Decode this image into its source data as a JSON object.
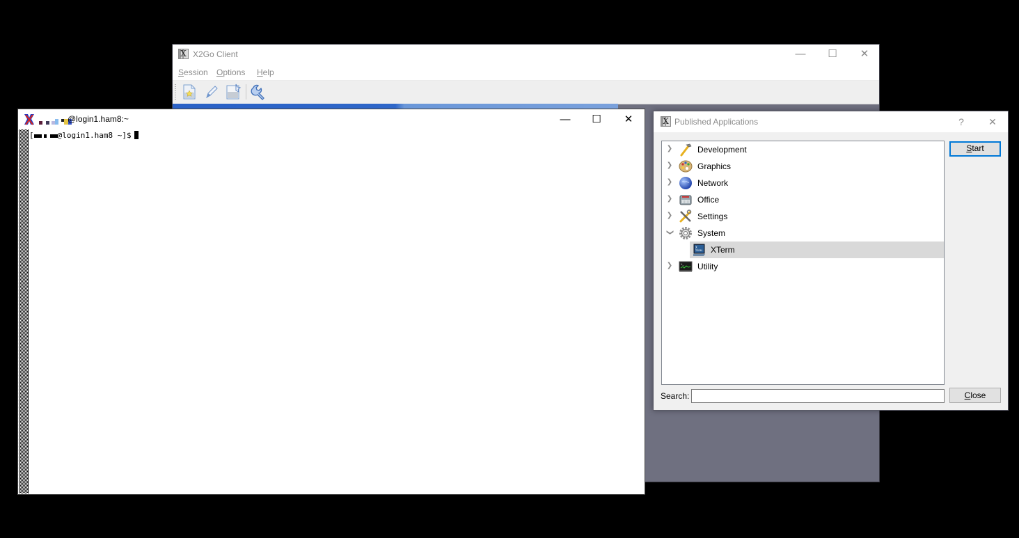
{
  "x2go": {
    "title": "X2Go Client",
    "menu": [
      {
        "label": "Session",
        "mnemonic": "S",
        "rest": "ession"
      },
      {
        "label": "Options",
        "mnemonic": "O",
        "rest": "ptions"
      },
      {
        "label": "Help",
        "mnemonic": "H",
        "rest": "elp"
      }
    ],
    "toolbar": [
      {
        "name": "new-session",
        "icon": "new-session-icon"
      },
      {
        "name": "edit-session",
        "icon": "pencil-icon"
      },
      {
        "name": "create-shortcut",
        "icon": "shortcut-icon"
      },
      {
        "name": "preferences",
        "icon": "wrench-icon"
      }
    ],
    "window_buttons": {
      "minimize": "—",
      "maximize": "☐",
      "close": "✕"
    }
  },
  "xterm": {
    "title_suffix": "@login1.ham8:~",
    "prompt_prefix": "[",
    "prompt_suffix": "@login1.ham8 ~]$",
    "window_buttons": {
      "minimize": "—",
      "maximize": "☐",
      "close": "✕"
    }
  },
  "published_apps": {
    "title": "Published Applications",
    "help_button": "?",
    "close_x": "✕",
    "categories": [
      {
        "label": "Development",
        "icon": "hammer-icon",
        "expanded": false
      },
      {
        "label": "Graphics",
        "icon": "palette-icon",
        "expanded": false
      },
      {
        "label": "Network",
        "icon": "globe-icon",
        "expanded": false
      },
      {
        "label": "Office",
        "icon": "typewriter-icon",
        "expanded": false
      },
      {
        "label": "Settings",
        "icon": "tools-icon",
        "expanded": false
      },
      {
        "label": "System",
        "icon": "gear-icon",
        "expanded": true,
        "children": [
          {
            "label": "XTerm",
            "icon": "xterm-icon",
            "selected": true
          }
        ]
      },
      {
        "label": "Utility",
        "icon": "terminal-monitor-icon",
        "expanded": false
      }
    ],
    "start_button": {
      "mnemonic": "S",
      "rest": "tart"
    },
    "close_button": {
      "mnemonic": "C",
      "rest": "lose"
    },
    "search_label": "Search:",
    "search_value": ""
  }
}
